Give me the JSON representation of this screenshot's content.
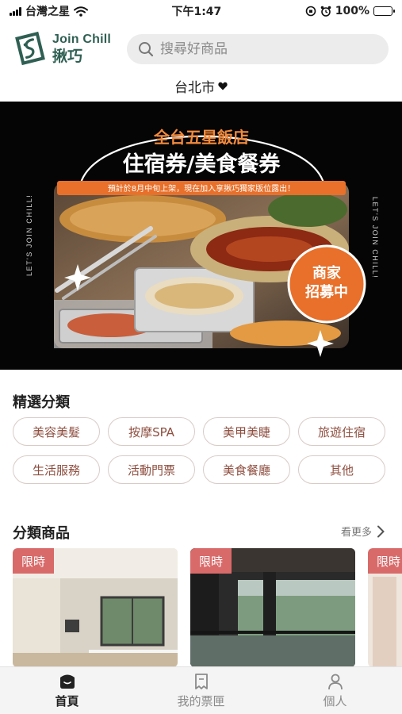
{
  "status_bar": {
    "carrier": "台灣之星",
    "time": "下午1:47",
    "battery": "100%"
  },
  "header": {
    "logo_en": "Join Chill",
    "logo_zh": "揪巧",
    "search_placeholder": "搜尋好商品",
    "city": "台北市"
  },
  "banner": {
    "title_top": "全台五星飯店",
    "title_main": "住宿券/美食餐券",
    "notice": "預計於8月中旬上架，現在加入享揪巧獨家版位露出！",
    "badge_line1": "商家",
    "badge_line2": "招募中",
    "side_text": "LET'S JOIN CHILL!"
  },
  "featured": {
    "title": "精選分類",
    "chips": [
      "美容美髮",
      "按摩SPA",
      "美甲美睫",
      "旅遊住宿",
      "生活服務",
      "活動門票",
      "美食餐廳",
      "其他"
    ]
  },
  "products": {
    "title": "分類商品",
    "more": "看更多",
    "tag": "限時"
  },
  "tabbar": {
    "items": [
      "首頁",
      "我的票匣",
      "個人"
    ]
  },
  "colors": {
    "brand_green": "#2f5f52",
    "chip_text": "#8e4e3f",
    "chip_border": "#d9cbc6",
    "tag_bg": "#d86a6a",
    "banner_orange": "#e8702a"
  }
}
